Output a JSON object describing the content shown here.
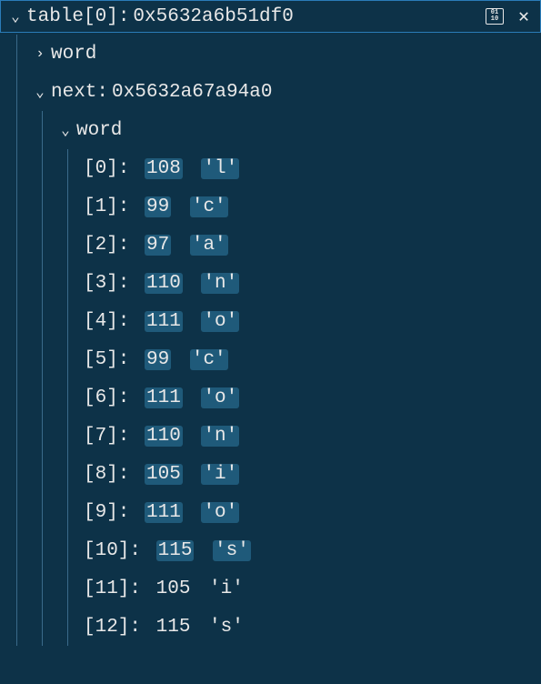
{
  "header": {
    "title_prefix": "table[0]:",
    "title_value": "0x5632a6b51df0"
  },
  "tree": {
    "word_collapsed": {
      "label": "word"
    },
    "next": {
      "label": "next:",
      "value": "0x5632a67a94a0"
    },
    "word_expanded": {
      "label": "word",
      "items": [
        {
          "index": "[0]:",
          "num": "108",
          "char": "'l'",
          "highlight": true
        },
        {
          "index": "[1]:",
          "num": "99",
          "char": "'c'",
          "highlight": true
        },
        {
          "index": "[2]:",
          "num": "97",
          "char": "'a'",
          "highlight": true
        },
        {
          "index": "[3]:",
          "num": "110",
          "char": "'n'",
          "highlight": true
        },
        {
          "index": "[4]:",
          "num": "111",
          "char": "'o'",
          "highlight": true
        },
        {
          "index": "[5]:",
          "num": "99",
          "char": "'c'",
          "highlight": true
        },
        {
          "index": "[6]:",
          "num": "111",
          "char": "'o'",
          "highlight": true
        },
        {
          "index": "[7]:",
          "num": "110",
          "char": "'n'",
          "highlight": true
        },
        {
          "index": "[8]:",
          "num": "105",
          "char": "'i'",
          "highlight": true
        },
        {
          "index": "[9]:",
          "num": "111",
          "char": "'o'",
          "highlight": true
        },
        {
          "index": "[10]:",
          "num": "115",
          "char": "'s'",
          "highlight": true
        },
        {
          "index": "[11]:",
          "num": "105",
          "char": "'i'",
          "highlight": false
        },
        {
          "index": "[12]:",
          "num": "115",
          "char": "'s'",
          "highlight": false
        }
      ]
    }
  }
}
